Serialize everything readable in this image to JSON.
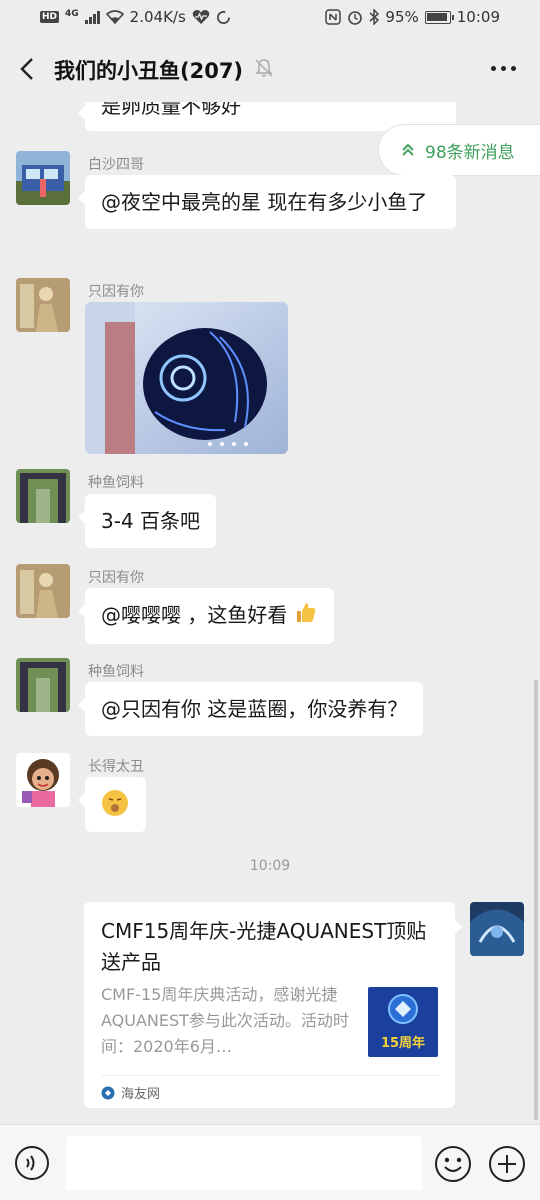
{
  "status_bar": {
    "hd": "HD",
    "network": "4G",
    "speed": "2.04K/s",
    "battery": "95%",
    "time": "10:09"
  },
  "header": {
    "title": "我们的小丑鱼(207)"
  },
  "new_messages": {
    "label": "98条新消息"
  },
  "messages": [
    {
      "text": "是卵质量不够好"
    },
    {
      "sender": "白沙四哥",
      "text": "@夜空中最亮的星  现在有多少小鱼了"
    },
    {
      "sender": "只因有你"
    },
    {
      "sender": "种鱼饲料",
      "text": "3-4 百条吧"
    },
    {
      "sender": "只因有你",
      "text": "@嘤嘤嘤 ，这鱼好看"
    },
    {
      "sender": "种鱼饲料",
      "text": "@只因有你  这是蓝圈，你没养有？"
    },
    {
      "sender": "长得太丑"
    }
  ],
  "time_divider": "10:09",
  "link_card": {
    "title": "CMF15周年庆-光捷AQUANEST顶贴送产品",
    "description": "CMF-15周年庆典活动，感谢光捷AQUANEST参与此次活动。活动时间：2020年6月…",
    "thumb_text": "15周年",
    "source": "海友网"
  },
  "input_bar": {
    "placeholder": ""
  },
  "colors": {
    "background": "#ededed",
    "accent_green": "#3ea05b",
    "bubble": "#ffffff"
  }
}
